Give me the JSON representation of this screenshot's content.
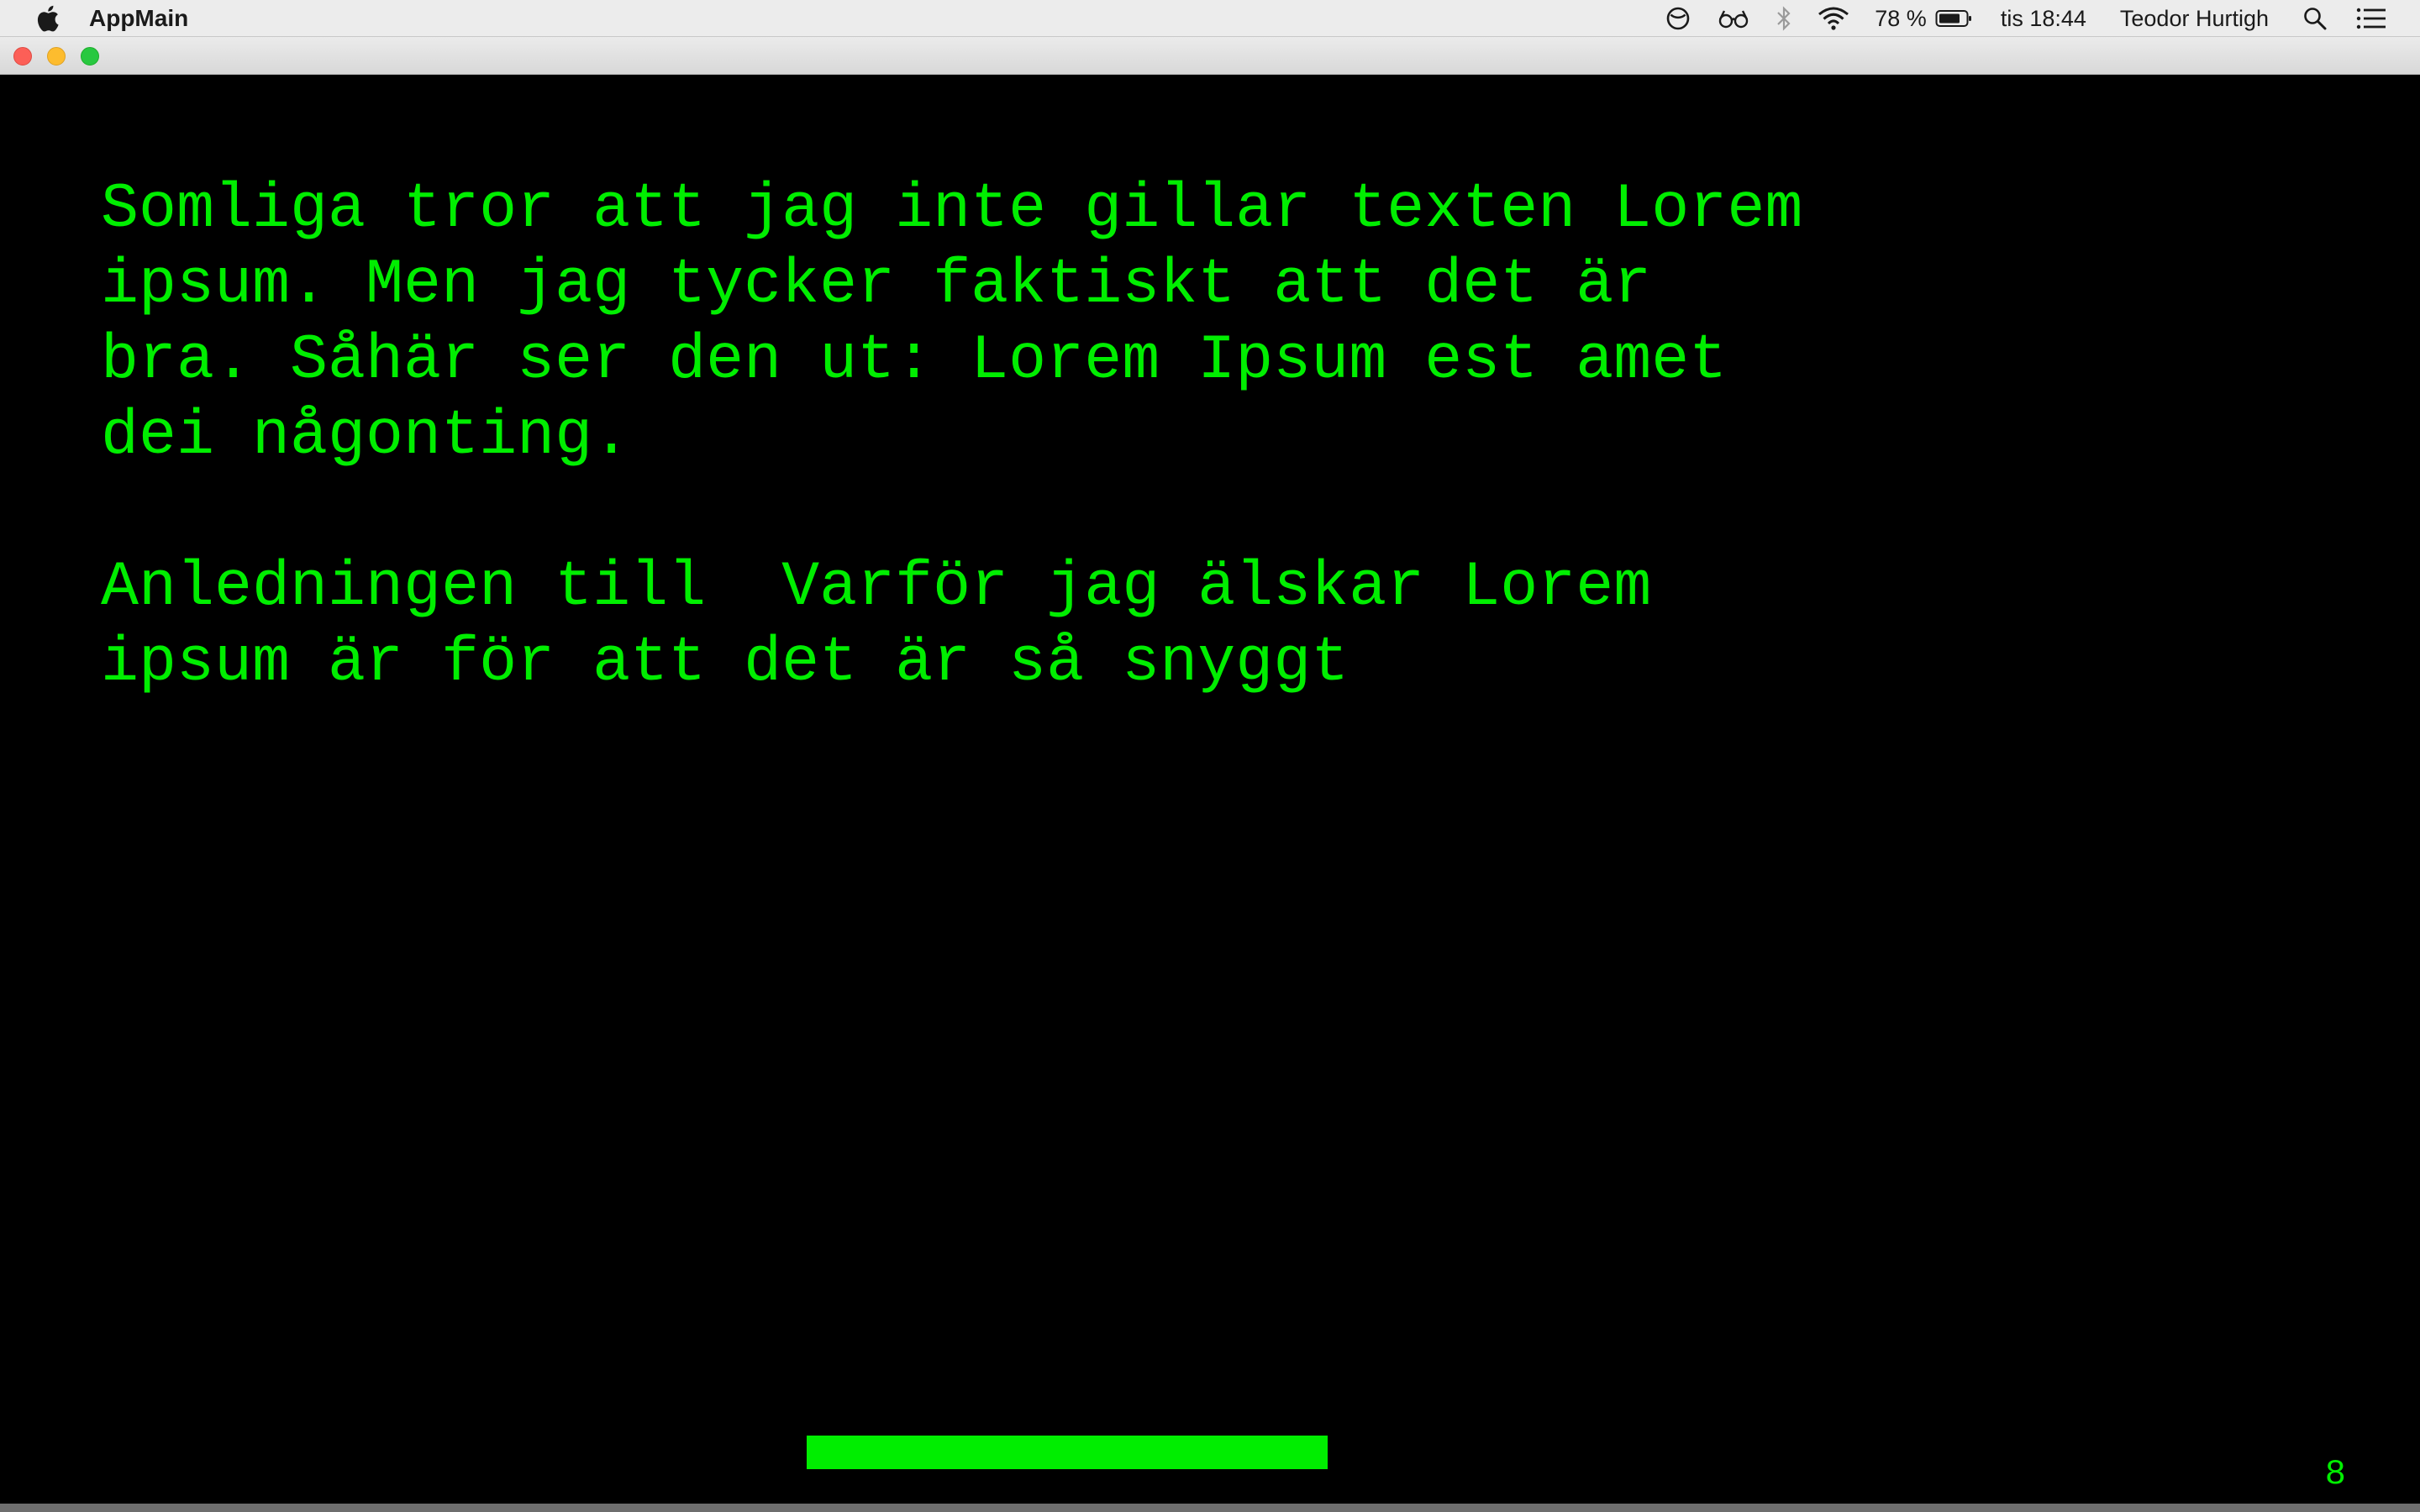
{
  "menubar": {
    "app_name": "AppMain",
    "battery_percent": "78 %",
    "clock": "tis 18:44",
    "user": "Teodor Hurtigh",
    "icons": [
      "apple-icon",
      "do-not-disturb-icon",
      "glasses-icon",
      "bluetooth-icon",
      "wifi-icon",
      "battery-icon",
      "spotlight-search-icon",
      "notification-center-icon"
    ]
  },
  "window": {
    "paragraph_1": "Somliga tror att jag inte gillar texten Lorem\nipsum. Men jag tycker faktiskt att det är\nbra. Såhär ser den ut: Lorem Ipsum est amet\ndei någonting.",
    "paragraph_2": "Anledningen till  Varför jag älskar Lorem\nipsum är för att det är så snyggt",
    "score": "8",
    "text_color": "#00ee00",
    "background_color": "#000000"
  }
}
